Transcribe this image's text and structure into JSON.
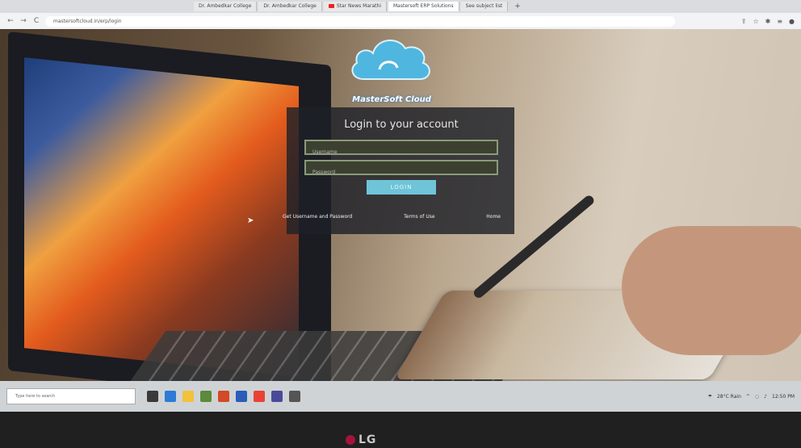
{
  "browser": {
    "tabs": [
      {
        "label": "Dr. Ambedkar College"
      },
      {
        "label": "Dr. Ambedkar College"
      },
      {
        "label": "Star News Marathi"
      },
      {
        "label": "Mastersoft ERP Solutions"
      },
      {
        "label": "See subject list"
      }
    ],
    "new_tab_label": "+",
    "address": "mastersoftcloud.in/erp/login",
    "nav": {
      "back": "←",
      "forward": "→",
      "reload": "C"
    }
  },
  "brand": {
    "name": "MasterSoft Cloud"
  },
  "login": {
    "title": "Login to your account",
    "username_placeholder": "Username",
    "password_placeholder": "Password",
    "login_button": "LOGIN",
    "links": {
      "forgot": "Get Username and Password",
      "terms": "Terms of Use",
      "home": "Home"
    }
  },
  "taskbar": {
    "search_placeholder": "Type here to search",
    "weather": "28°C Rain",
    "time": "12:50 PM"
  },
  "monitor": {
    "brand": "LG"
  },
  "colors": {
    "login_button": "#6fc4d8",
    "panel": "#1e2128",
    "cloud": "#4fb6e0"
  }
}
